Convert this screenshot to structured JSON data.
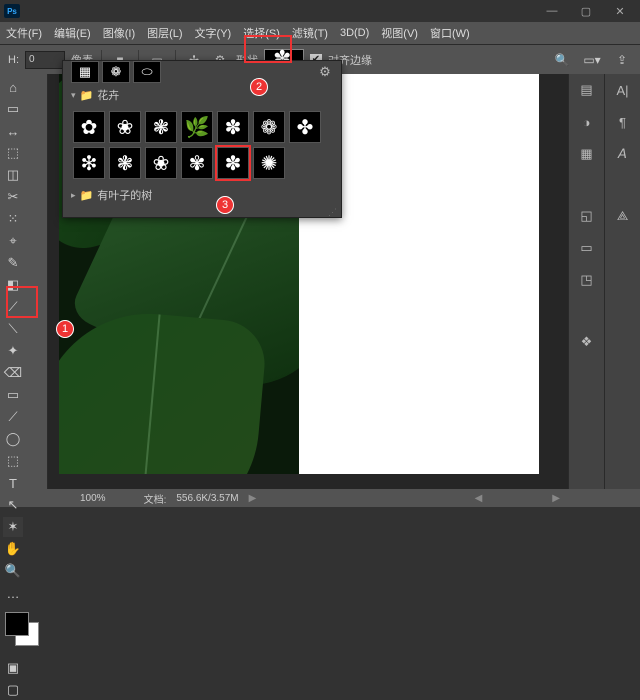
{
  "app": {
    "logo": "Ps"
  },
  "window": {
    "minimize": "—",
    "maximize": "▢",
    "close": "✕"
  },
  "menu": [
    "文件(F)",
    "编辑(E)",
    "图像(I)",
    "图层(L)",
    "文字(Y)",
    "选择(S)",
    "滤镜(T)",
    "3D(D)",
    "视图(V)",
    "窗口(W)"
  ],
  "optbar": {
    "H_label": "H:",
    "H_value": "0",
    "H_unit": "像素",
    "shape_label": "形状",
    "align_label": "对齐边缘"
  },
  "popup": {
    "group_open": "花卉",
    "group_closed": "有叶子的树",
    "recent": [
      "▦",
      "❁",
      "⬭"
    ],
    "shapes_row1": [
      "✿",
      "❀",
      "❃",
      "🌿",
      "✽",
      "❁",
      "✤"
    ],
    "shapes_row2": [
      "❇",
      "❃",
      "❀",
      "✾",
      "✽",
      "✺"
    ],
    "gear": "⚙"
  },
  "annotations": {
    "b1": "1",
    "b2": "2",
    "b3": "3"
  },
  "status": {
    "zoom": "100%",
    "doc_label": "文档:",
    "size": "556.6K/3.57M",
    "arrow": "▶"
  },
  "panels": {
    "col1": [
      "▤",
      "◑",
      "▦",
      "",
      "◱",
      "▭",
      "◳",
      "",
      "❖"
    ],
    "col2": [
      "A|",
      "¶",
      "𝘈",
      "",
      "⟁",
      "",
      "",
      ""
    ]
  },
  "tools": {
    "grid": [
      "⌂",
      "▭",
      "↔",
      "⬚",
      "◫",
      "✂",
      "⁙",
      "⌖",
      "✎",
      "◧",
      "⟋",
      "⟍",
      "✦",
      "⌫",
      "▭",
      "⟋",
      "◯",
      "⬚",
      "T",
      "↖",
      "✶",
      "✋",
      "🔍",
      "…"
    ]
  }
}
